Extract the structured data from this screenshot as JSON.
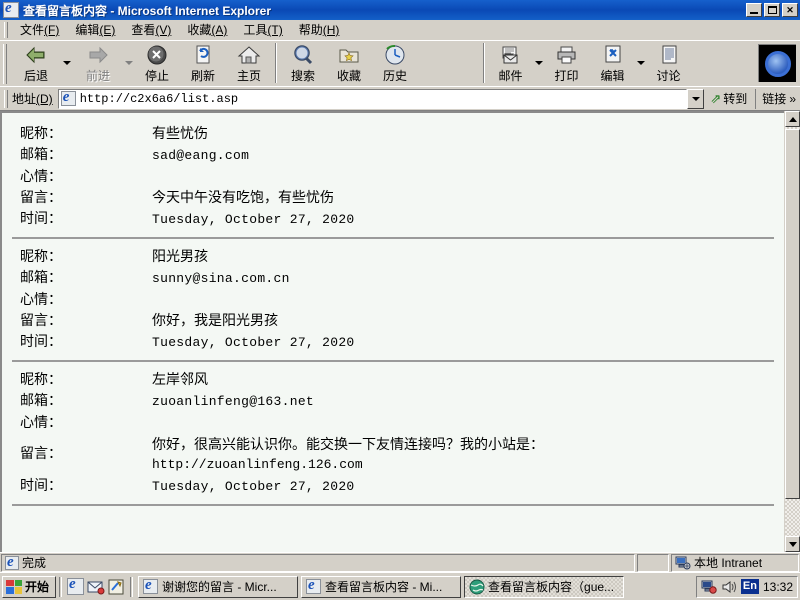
{
  "window": {
    "title": "查看留言板内容 - Microsoft Internet Explorer",
    "minimize_label": "_",
    "maximize_label": "❐",
    "close_label": "✕"
  },
  "menu": [
    {
      "label": "文件",
      "accel": "(F)"
    },
    {
      "label": "编辑",
      "accel": "(E)"
    },
    {
      "label": "查看",
      "accel": "(V)"
    },
    {
      "label": "收藏",
      "accel": "(A)"
    },
    {
      "label": "工具",
      "accel": "(T)"
    },
    {
      "label": "帮助",
      "accel": "(H)"
    }
  ],
  "toolbar": {
    "back": "后退",
    "forward": "前进",
    "stop": "停止",
    "refresh": "刷新",
    "home": "主页",
    "search": "搜索",
    "favorites": "收藏",
    "history": "历史",
    "mail": "邮件",
    "print": "打印",
    "edit": "编辑",
    "discuss": "讨论"
  },
  "address": {
    "label": "地址",
    "accel": "(D)",
    "url": "http://c2x6a6/list.asp",
    "go": "转到",
    "links": "链接",
    "links_chevron": "»"
  },
  "page": {
    "labels": {
      "nickname": "昵称：",
      "email": "邮箱：",
      "mood": "心情：",
      "message": "留言：",
      "time": "时间："
    },
    "entries": [
      {
        "nickname": "有些忧伤",
        "email": "sad@eang.com",
        "mood": "",
        "message": "今天中午没有吃饱，有些忧伤",
        "message_line2": "",
        "time": "Tuesday, October 27, 2020"
      },
      {
        "nickname": "阳光男孩",
        "email": "sunny@sina.com.cn",
        "mood": "",
        "message": "你好，我是阳光男孩",
        "message_line2": "",
        "time": "Tuesday, October 27, 2020"
      },
      {
        "nickname": "左岸邻风",
        "email": "zuoanlinfeng@163.net",
        "mood": "",
        "message": "你好，很高兴能认识你。能交换一下友情连接吗？我的小站是：",
        "message_line2": "http://zuoanlinfeng.126.com",
        "time": "Tuesday, October 27, 2020"
      }
    ]
  },
  "statusbar": {
    "status": "完成",
    "zone": "本地 Intranet"
  },
  "taskbar": {
    "start": "开始",
    "tasks": [
      {
        "label": "谢谢您的留言 - Micr...",
        "icon": "ie-icon",
        "active": false
      },
      {
        "label": "查看留言板内容 - Mi...",
        "icon": "ie-icon",
        "active": false
      },
      {
        "label": "查看留言板内容（gue...",
        "icon": "globe-icon",
        "active": true
      }
    ],
    "language": "En",
    "clock": "13:32"
  }
}
